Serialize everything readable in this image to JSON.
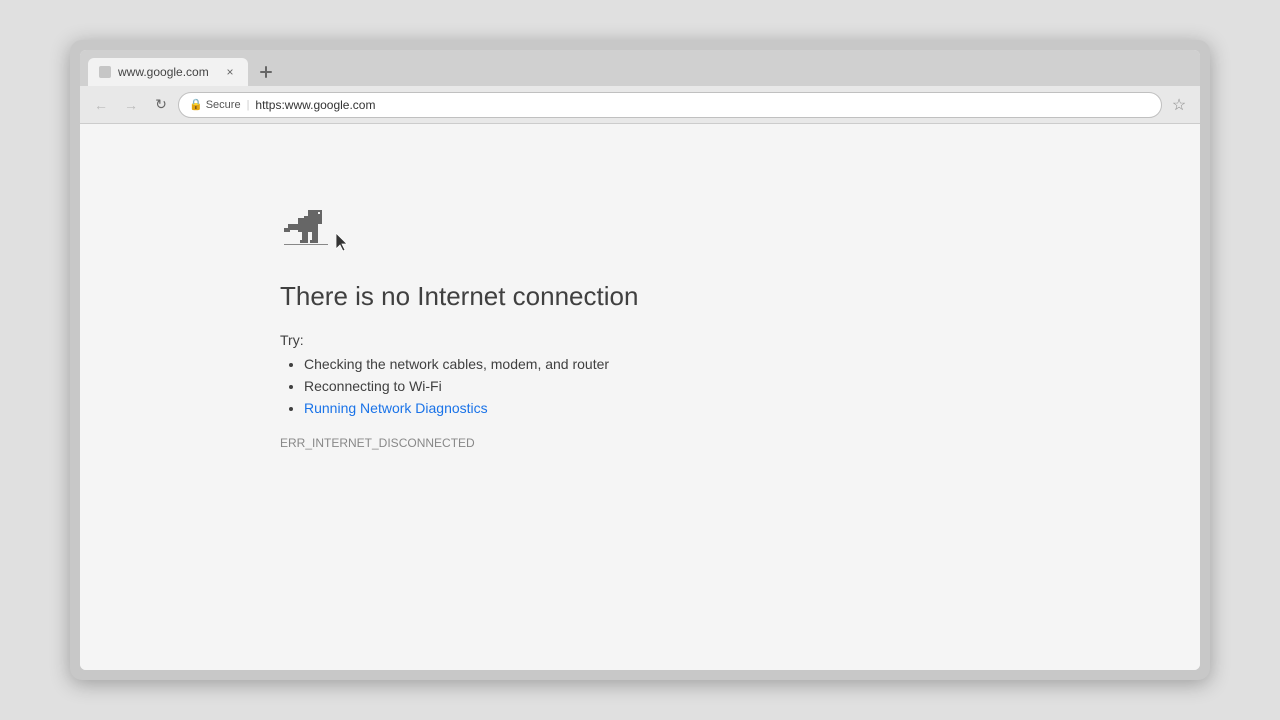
{
  "browser": {
    "tab": {
      "favicon": "page-icon",
      "title": "www.google.com",
      "close_label": "×"
    },
    "new_tab_label": "+",
    "nav": {
      "back_label": "←",
      "forward_label": "→",
      "reload_label": "↻",
      "secure_label": "Secure",
      "url": "https:www.google.com",
      "star_label": "☆"
    }
  },
  "page": {
    "dino_icon": "dino-icon",
    "error_title": "There is no Internet connection",
    "try_label": "Try:",
    "suggestions": [
      {
        "text": "Checking the network cables, modem, and router",
        "link": false
      },
      {
        "text": "Reconnecting to Wi-Fi",
        "link": false
      },
      {
        "text": "Running Network Diagnostics",
        "link": true
      }
    ],
    "error_code": "ERR_INTERNET_DISCONNECTED"
  }
}
